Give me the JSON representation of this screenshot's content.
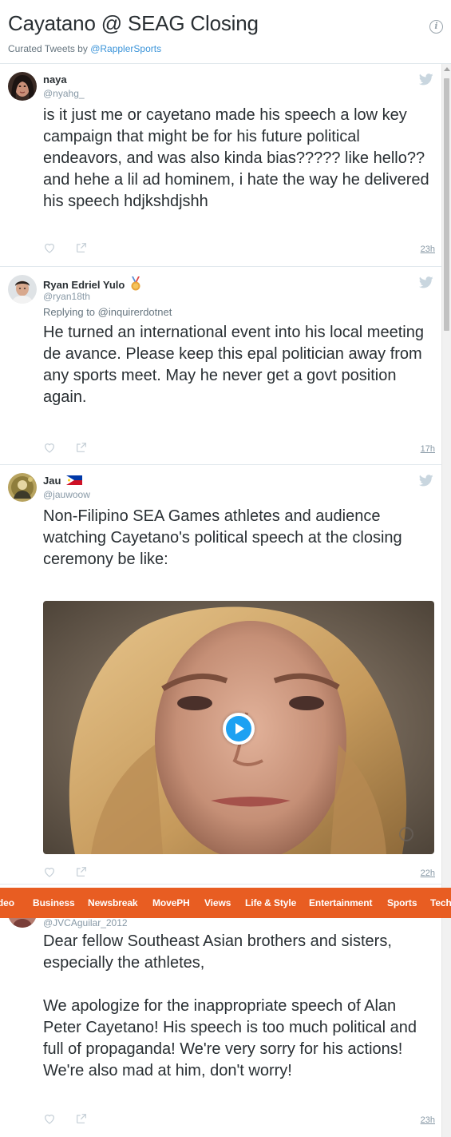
{
  "header": {
    "title": "Cayatano @ SEAG Closing",
    "curated_prefix": "Curated Tweets by",
    "curated_by": "@RapplerSports",
    "info_icon": "info-icon"
  },
  "tweets": [
    {
      "name": "naya",
      "handle": "@nyahg_",
      "reply_to": "",
      "text": "is it just me or cayetano made his speech a low key campaign that might be for his future political endeavors, and was also kinda bias????? like hello?? and hehe a lil ad hominem, i hate the way he delivered his speech hdjkshdjshh",
      "time": "23h"
    },
    {
      "name": "Ryan Edriel Yulo",
      "handle": "@ryan18th",
      "reply_to": "Replying to @inquirerdotnet",
      "text": "He turned an international event into his local meeting de avance. Please keep this epal politician away from any sports meet. May he never get a govt position again.",
      "time": "17h",
      "badge": "medal-icon"
    },
    {
      "name": "Jau",
      "handle": "@jauwoow",
      "reply_to": "",
      "text": "Non-Filipino SEA Games athletes and audience watching Cayetano's political speech at the closing ceremony be like:",
      "time": "22h",
      "badge": "philippine-flag-icon",
      "media": "video-thumbnail"
    },
    {
      "name": "",
      "handle": "@JVCAguilar_2012",
      "reply_to": "",
      "text": "Dear fellow Southeast Asian brothers and sisters, especially the athletes,\n\nWe apologize for the inappropriate speech of Alan Peter Cayetano! His speech is too much political and full of propaganda! We're very sorry for his actions! We're also mad at him, don't worry!",
      "time": "23h"
    }
  ],
  "navbar": {
    "items": [
      "Video",
      "Business",
      "Newsbreak",
      "MovePH",
      "Views",
      "Life & Style",
      "Entertainment",
      "Sports",
      "Tech"
    ],
    "color": "#e85d22"
  },
  "colors": {
    "link": "#3b94d9",
    "muted": "#8899a6",
    "text": "#292f33",
    "play": "#1da1f2"
  }
}
